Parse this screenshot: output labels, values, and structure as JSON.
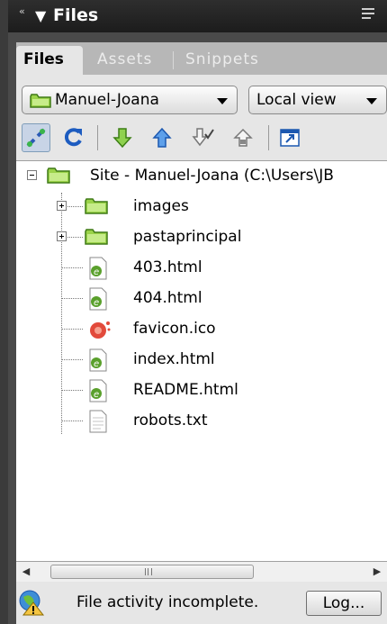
{
  "panel": {
    "title": "Files"
  },
  "tabs": [
    {
      "label": "Files",
      "active": true
    },
    {
      "label": "Assets",
      "active": false
    },
    {
      "label": "Snippets",
      "active": false
    }
  ],
  "site_dropdown": {
    "selected": "Manuel-Joana"
  },
  "view_dropdown": {
    "selected": "Local view"
  },
  "toolbar": {
    "buttons": [
      {
        "icon": "connect-icon",
        "pressed": true
      },
      {
        "icon": "refresh-icon"
      },
      {
        "icon": "get-files-icon"
      },
      {
        "icon": "put-files-icon"
      },
      {
        "icon": "check-out-icon"
      },
      {
        "icon": "check-in-icon"
      },
      {
        "icon": "expand-view-icon"
      }
    ]
  },
  "tree": {
    "root": {
      "label": "Site - Manuel-Joana (C:\\Users\\JB",
      "expanded": true
    },
    "items": [
      {
        "name": "images",
        "type": "folder",
        "collapsed": true
      },
      {
        "name": "pastaprincipal",
        "type": "folder",
        "collapsed": true
      },
      {
        "name": "403.html",
        "type": "html"
      },
      {
        "name": "404.html",
        "type": "html"
      },
      {
        "name": "favicon.ico",
        "type": "ico"
      },
      {
        "name": "index.html",
        "type": "html"
      },
      {
        "name": "README.html",
        "type": "html"
      },
      {
        "name": "robots.txt",
        "type": "txt"
      }
    ]
  },
  "scrollbar": {
    "thumb_glyph": "III"
  },
  "status": {
    "text": "File activity incomplete.",
    "log_button": "Log..."
  },
  "colors": {
    "folder_green": "#8cc63f",
    "html_green": "#5aa02c",
    "ico_red": "#e24a3b",
    "title_bar": "#1c1c1c"
  }
}
